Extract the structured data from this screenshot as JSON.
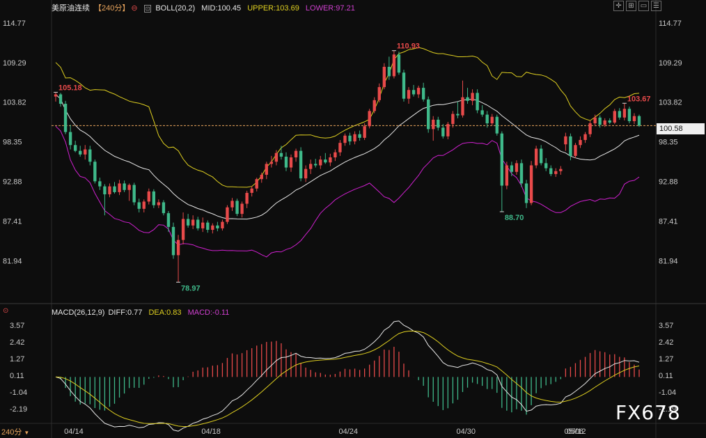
{
  "header": {
    "symbol": "美原油连续",
    "period": "【240分】",
    "boll_label": "BOLL(20,2)",
    "mid": "MID:100.45",
    "upper": "UPPER:103.69",
    "lower": "LOWER:97.21"
  },
  "macd_header": {
    "label": "MACD(26,12,9)",
    "diff": "DIFF:0.77",
    "dea": "DEA:0.83",
    "macd": "MACD:-0.11"
  },
  "period_label": "240分",
  "watermark": "FX678",
  "current_price": "100.58",
  "colors": {
    "up": "#e84a4a",
    "down": "#3fb98a",
    "upper": "#e0d020",
    "mid": "#e8e8e8",
    "lower": "#d020d0",
    "diff": "#e8e8e8",
    "dea": "#e0d020",
    "price_line": "#e8a45c"
  },
  "chart_data": {
    "type": "candlestick",
    "y_ticks": [
      "114.77",
      "109.29",
      "103.82",
      "98.35",
      "92.88",
      "87.41",
      "81.94"
    ],
    "y_range": [
      76.4,
      116.0
    ],
    "x_ticks": [
      "04/14",
      "04/18",
      "04/24",
      "04/30",
      "05/06",
      "05/12"
    ],
    "annotations": [
      {
        "text": "105.18",
        "type": "high"
      },
      {
        "text": "78.97",
        "type": "low"
      },
      {
        "text": "110.93",
        "type": "high"
      },
      {
        "text": "88.70",
        "type": "low"
      },
      {
        "text": "103.67",
        "type": "high"
      }
    ],
    "candles": [
      [
        104.6,
        105.2,
        103.9,
        104.9
      ],
      [
        104.9,
        105.1,
        103.2,
        103.6
      ],
      [
        103.6,
        104.0,
        99.4,
        99.7
      ],
      [
        99.7,
        100.7,
        97.3,
        97.9
      ],
      [
        97.9,
        98.5,
        96.9,
        97.1
      ],
      [
        97.1,
        97.8,
        96.3,
        96.6
      ],
      [
        96.6,
        97.9,
        95.9,
        97.3
      ],
      [
        97.3,
        97.8,
        95.1,
        95.6
      ],
      [
        95.6,
        95.9,
        92.6,
        92.9
      ],
      [
        92.9,
        93.4,
        91.7,
        92.2
      ],
      [
        92.2,
        92.5,
        88.2,
        91.1
      ],
      [
        91.1,
        92.6,
        90.7,
        92.2
      ],
      [
        92.2,
        92.8,
        91.2,
        91.4
      ],
      [
        91.4,
        93.1,
        91.0,
        92.6
      ],
      [
        92.6,
        93.0,
        91.4,
        91.7
      ],
      [
        91.7,
        92.6,
        90.2,
        92.4
      ],
      [
        92.4,
        92.7,
        89.6,
        90.0
      ],
      [
        90.0,
        90.5,
        88.6,
        89.1
      ],
      [
        89.1,
        90.4,
        88.6,
        90.1
      ],
      [
        90.1,
        91.9,
        89.7,
        91.5
      ],
      [
        91.5,
        91.8,
        89.2,
        89.6
      ],
      [
        89.6,
        90.4,
        89.2,
        90.0
      ],
      [
        90.0,
        90.3,
        88.2,
        88.5
      ],
      [
        88.5,
        88.8,
        85.9,
        86.6
      ],
      [
        86.6,
        87.2,
        82.2,
        82.7
      ],
      [
        82.7,
        85.5,
        78.97,
        84.8
      ],
      [
        84.8,
        88.6,
        84.2,
        87.7
      ],
      [
        87.7,
        88.4,
        86.5,
        86.8
      ],
      [
        86.8,
        88.2,
        86.3,
        87.6
      ],
      [
        87.6,
        88.0,
        86.1,
        86.4
      ],
      [
        86.4,
        87.9,
        85.9,
        87.2
      ],
      [
        87.2,
        87.5,
        85.8,
        86.2
      ],
      [
        86.2,
        87.1,
        85.7,
        86.8
      ],
      [
        86.8,
        87.3,
        86.0,
        86.4
      ],
      [
        86.4,
        87.6,
        86.1,
        87.3
      ],
      [
        87.3,
        89.6,
        87.0,
        89.3
      ],
      [
        89.3,
        90.6,
        88.8,
        90.2
      ],
      [
        90.2,
        90.5,
        88.1,
        88.4
      ],
      [
        88.4,
        90.1,
        87.9,
        89.8
      ],
      [
        89.8,
        91.6,
        89.2,
        91.3
      ],
      [
        91.3,
        92.2,
        90.8,
        91.9
      ],
      [
        91.9,
        93.4,
        91.5,
        93.2
      ],
      [
        93.2,
        94.1,
        92.7,
        93.8
      ],
      [
        93.8,
        95.6,
        93.2,
        95.3
      ],
      [
        95.3,
        96.4,
        94.8,
        95.6
      ],
      [
        95.6,
        97.2,
        95.1,
        96.8
      ],
      [
        96.8,
        97.8,
        95.9,
        96.3
      ],
      [
        96.3,
        96.9,
        94.3,
        94.8
      ],
      [
        94.8,
        96.6,
        94.2,
        96.2
      ],
      [
        96.2,
        97.4,
        95.6,
        97.1
      ],
      [
        97.1,
        97.6,
        92.9,
        93.3
      ],
      [
        93.3,
        95.1,
        92.8,
        94.6
      ],
      [
        94.6,
        95.9,
        93.9,
        95.3
      ],
      [
        95.3,
        96.0,
        94.8,
        95.1
      ],
      [
        95.1,
        96.4,
        94.6,
        95.9
      ],
      [
        95.9,
        96.8,
        95.3,
        95.5
      ],
      [
        95.5,
        96.7,
        95.0,
        96.2
      ],
      [
        96.2,
        97.3,
        95.7,
        96.9
      ],
      [
        96.9,
        98.6,
        96.4,
        98.2
      ],
      [
        98.2,
        99.5,
        97.8,
        99.2
      ],
      [
        99.2,
        99.6,
        97.9,
        98.4
      ],
      [
        98.4,
        99.8,
        98.0,
        99.4
      ],
      [
        99.4,
        99.9,
        98.5,
        98.9
      ],
      [
        98.9,
        100.9,
        98.6,
        100.5
      ],
      [
        100.5,
        102.9,
        100.2,
        102.6
      ],
      [
        102.6,
        104.5,
        102.3,
        104.1
      ],
      [
        104.1,
        106.4,
        103.8,
        105.9
      ],
      [
        105.9,
        109.2,
        105.6,
        108.7
      ],
      [
        108.7,
        110.1,
        106.9,
        107.4
      ],
      [
        107.4,
        110.93,
        107.1,
        110.4
      ],
      [
        110.4,
        110.8,
        107.6,
        107.9
      ],
      [
        107.9,
        108.3,
        103.9,
        104.3
      ],
      [
        104.3,
        105.9,
        103.6,
        105.5
      ],
      [
        105.5,
        106.2,
        104.6,
        104.9
      ],
      [
        104.9,
        106.1,
        104.4,
        105.8
      ],
      [
        105.8,
        106.5,
        103.9,
        104.2
      ],
      [
        104.2,
        104.6,
        99.6,
        100.1
      ],
      [
        100.1,
        101.9,
        98.5,
        101.4
      ],
      [
        101.4,
        101.8,
        99.9,
        100.3
      ],
      [
        100.3,
        100.8,
        98.8,
        99.1
      ],
      [
        99.1,
        101.1,
        98.7,
        100.8
      ],
      [
        100.8,
        102.6,
        100.3,
        102.2
      ],
      [
        102.2,
        103.9,
        101.6,
        102.0
      ],
      [
        102.0,
        106.8,
        101.7,
        104.5
      ],
      [
        104.5,
        105.8,
        103.6,
        104.0
      ],
      [
        104.0,
        105.6,
        103.4,
        105.1
      ],
      [
        105.1,
        105.6,
        102.3,
        102.7
      ],
      [
        102.7,
        103.4,
        101.8,
        102.1
      ],
      [
        102.1,
        102.6,
        100.3,
        100.9
      ],
      [
        100.9,
        102.2,
        100.6,
        101.8
      ],
      [
        101.8,
        102.1,
        99.2,
        99.5
      ],
      [
        99.5,
        99.8,
        88.7,
        92.3
      ],
      [
        92.3,
        95.6,
        91.8,
        95.1
      ],
      [
        95.1,
        95.6,
        93.6,
        94.2
      ],
      [
        94.2,
        95.8,
        93.8,
        95.4
      ],
      [
        95.4,
        95.9,
        92.1,
        92.6
      ],
      [
        92.6,
        93.1,
        89.2,
        89.9
      ],
      [
        89.9,
        95.7,
        89.6,
        95.1
      ],
      [
        95.1,
        97.8,
        94.7,
        97.4
      ],
      [
        97.4,
        97.9,
        95.1,
        95.4
      ],
      [
        95.4,
        96.1,
        94.3,
        94.7
      ],
      [
        94.7,
        95.1,
        93.6,
        93.9
      ],
      [
        93.9,
        94.7,
        93.5,
        94.3
      ],
      [
        94.3,
        95.0,
        93.8,
        94.6
      ],
      [
        98.0,
        99.6,
        97.1,
        99.1
      ],
      [
        99.1,
        99.5,
        95.8,
        96.4
      ],
      [
        96.4,
        98.2,
        96.1,
        97.9
      ],
      [
        97.9,
        99.1,
        97.5,
        98.6
      ],
      [
        98.6,
        99.7,
        98.2,
        99.4
      ],
      [
        99.4,
        101.3,
        99.0,
        100.9
      ],
      [
        100.9,
        102.1,
        100.5,
        101.7
      ],
      [
        101.7,
        102.0,
        100.3,
        100.7
      ],
      [
        100.7,
        101.6,
        100.4,
        101.3
      ],
      [
        101.3,
        101.6,
        100.8,
        101.0
      ],
      [
        101.0,
        102.9,
        100.8,
        102.6
      ],
      [
        102.6,
        103.0,
        101.4,
        101.7
      ],
      [
        101.7,
        103.67,
        101.3,
        102.9
      ],
      [
        102.9,
        103.2,
        100.9,
        101.2
      ],
      [
        101.2,
        102.3,
        100.8,
        101.9
      ],
      [
        101.9,
        102.1,
        100.4,
        100.58
      ]
    ],
    "macd_ticks": [
      "3.57",
      "2.42",
      "1.27",
      "0.11",
      "-1.04",
      "-2.19"
    ],
    "macd_range": [
      -3.1,
      3.9
    ]
  }
}
